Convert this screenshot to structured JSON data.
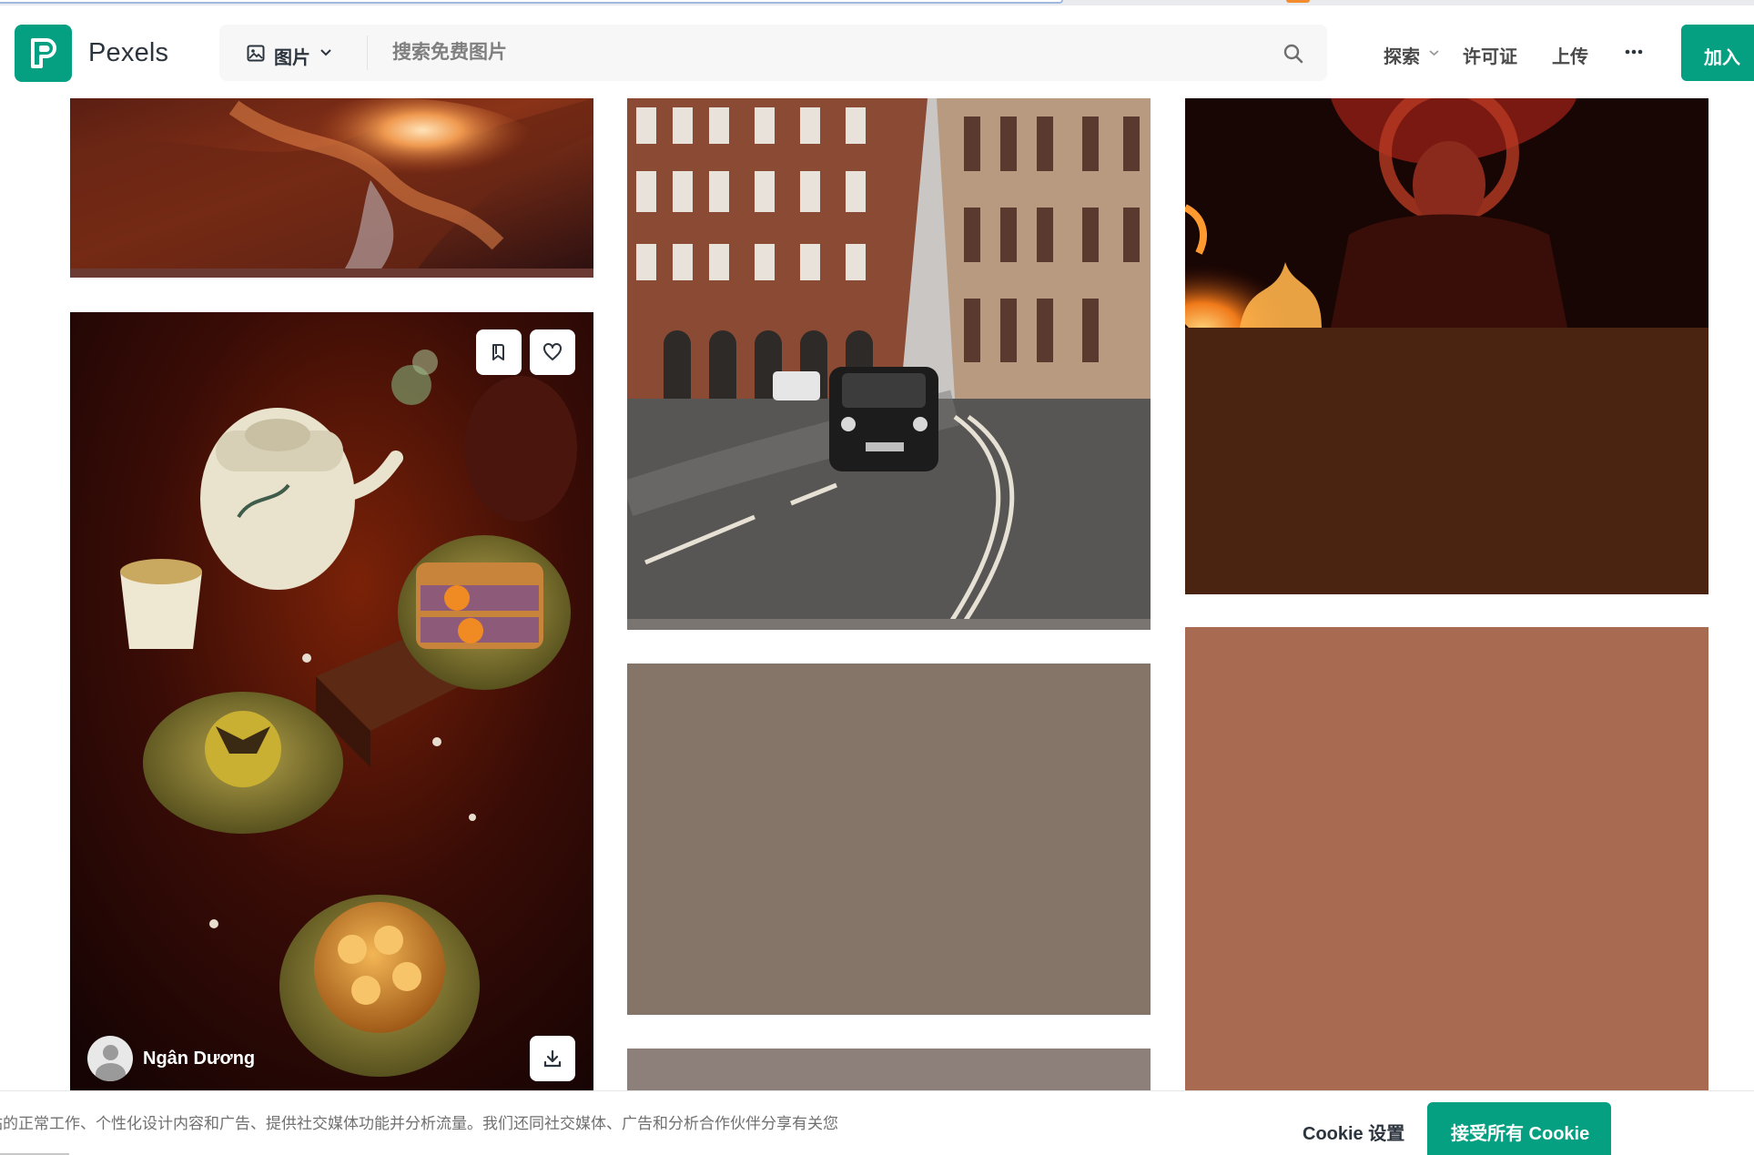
{
  "header": {
    "brand": "Pexels",
    "search_type_label": "图片",
    "search_placeholder": "搜索免费图片",
    "nav": {
      "explore": "探索",
      "license": "许可证",
      "upload": "上传"
    },
    "join_label": "加入"
  },
  "photos": {
    "featured": {
      "author_name": "Ngân Dương"
    }
  },
  "placeholders": {
    "gray1_color": "#857569",
    "gray2_color": "#8d807a",
    "fire_fill_color": "#4a2410",
    "terra_color": "#a86a50"
  },
  "cookie_banner": {
    "text": "站的正常工作、个性化设计内容和广告、提供社交媒体功能并分析流量。我们还同社交媒体、广告和分析合作伙伴分享有关您",
    "settings_label": "Cookie 设置",
    "accept_label": "接受所有 Cookie"
  },
  "theme": {
    "brand_green": "#05a081"
  },
  "icons": [
    "image-icon",
    "chevron-down-icon",
    "search-icon",
    "more-dots-icon",
    "collect-icon",
    "heart-icon",
    "download-icon",
    "user-avatar-icon"
  ]
}
